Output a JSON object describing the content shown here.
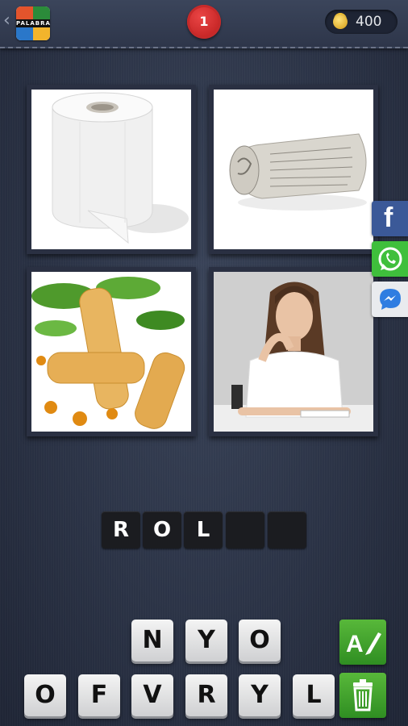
{
  "header": {
    "back_glyph": "‹",
    "logo_text": "PALABRA",
    "level": "1",
    "coins": "400"
  },
  "pictures": [
    {
      "name": "toilet-paper-roll",
      "icon": "paper-roll"
    },
    {
      "name": "rolled-newspaper",
      "icon": "newspaper"
    },
    {
      "name": "spring-rolls",
      "icon": "spring-rolls"
    },
    {
      "name": "bored-woman",
      "icon": "woman"
    }
  ],
  "share": [
    {
      "name": "facebook",
      "glyph": "f",
      "color": "#3b5998"
    },
    {
      "name": "whatsapp",
      "color": "#3fbf3c"
    },
    {
      "name": "messenger",
      "color": "#e9ebee"
    }
  ],
  "answer": {
    "slots": [
      "R",
      "O",
      "L",
      "",
      ""
    ]
  },
  "letters": {
    "row1": [
      "N",
      "Y",
      "O"
    ],
    "row2": [
      "O",
      "F",
      "V",
      "R",
      "Y",
      "L"
    ]
  },
  "colors": {
    "accent_green": "#3f9f2c",
    "badge_red": "#d22b2b"
  }
}
